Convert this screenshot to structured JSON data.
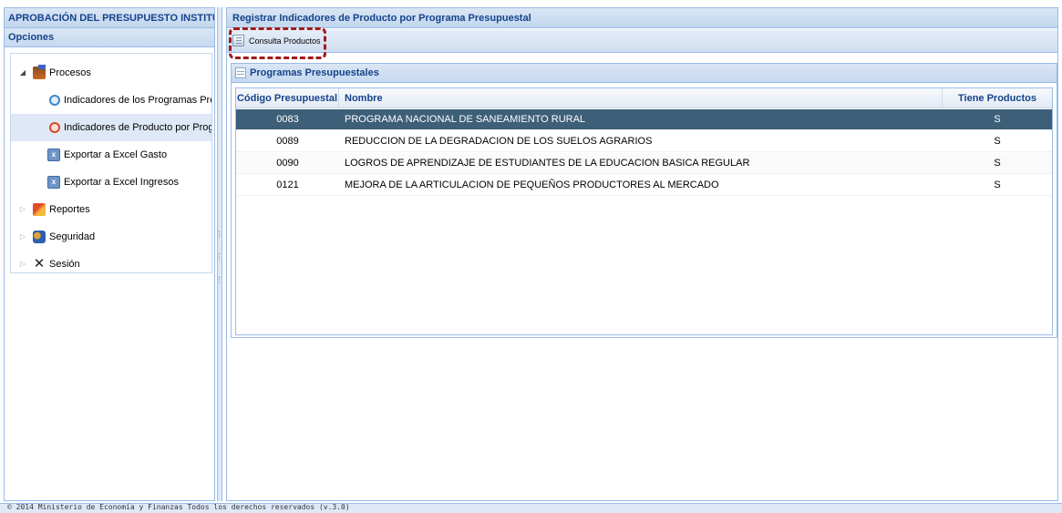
{
  "left_panel": {
    "title": "APROBACIÓN DEL PRESUPUESTO INSTITUCIONAL",
    "section": "Opciones",
    "tree": [
      {
        "label": "Procesos",
        "icon": "folder-icon",
        "expanded": true
      },
      {
        "label": "Indicadores de los Programas Presupuestales",
        "icon": "indicator-icon"
      },
      {
        "label": "Indicadores de Producto por Programa",
        "icon": "indicator-red-icon",
        "selected": true
      },
      {
        "label": "Exportar a Excel Gasto",
        "icon": "excel-icon"
      },
      {
        "label": "Exportar a Excel Ingresos",
        "icon": "excel-icon"
      },
      {
        "label": "Reportes",
        "icon": "report-icon",
        "expanded": false
      },
      {
        "label": "Seguridad",
        "icon": "users-icon",
        "expanded": false
      },
      {
        "label": "Sesión",
        "icon": "tools-icon",
        "expanded": false
      }
    ]
  },
  "main_panel": {
    "title": "Registrar Indicadores de Producto por Programa Presupuestal",
    "toolbar": {
      "consulta_label": "Consulta Productos"
    },
    "grid": {
      "title": "Programas Presupuestales",
      "columns": [
        "Código Presupuestal",
        "Nombre",
        "Tiene Productos"
      ],
      "rows": [
        {
          "codigo": "0083",
          "nombre": "PROGRAMA NACIONAL DE SANEAMIENTO RURAL",
          "tiene": "S"
        },
        {
          "codigo": "0089",
          "nombre": "REDUCCION DE LA DEGRADACION DE LOS SUELOS AGRARIOS",
          "tiene": "S"
        },
        {
          "codigo": "0090",
          "nombre": "LOGROS DE APRENDIZAJE DE ESTUDIANTES DE LA EDUCACION BASICA REGULAR",
          "tiene": "S"
        },
        {
          "codigo": "0121",
          "nombre": "MEJORA DE LA ARTICULACION DE PEQUEÑOS PRODUCTORES AL MERCADO",
          "tiene": "S"
        }
      ]
    }
  },
  "footer": {
    "text": "© 2014 Ministerio de Economía y Finanzas Todos los derechos reservados (v.3.0)"
  },
  "colors": {
    "header_text": "#15428b",
    "selected_row": "#3e5f78",
    "highlight": "#a31a1a"
  }
}
